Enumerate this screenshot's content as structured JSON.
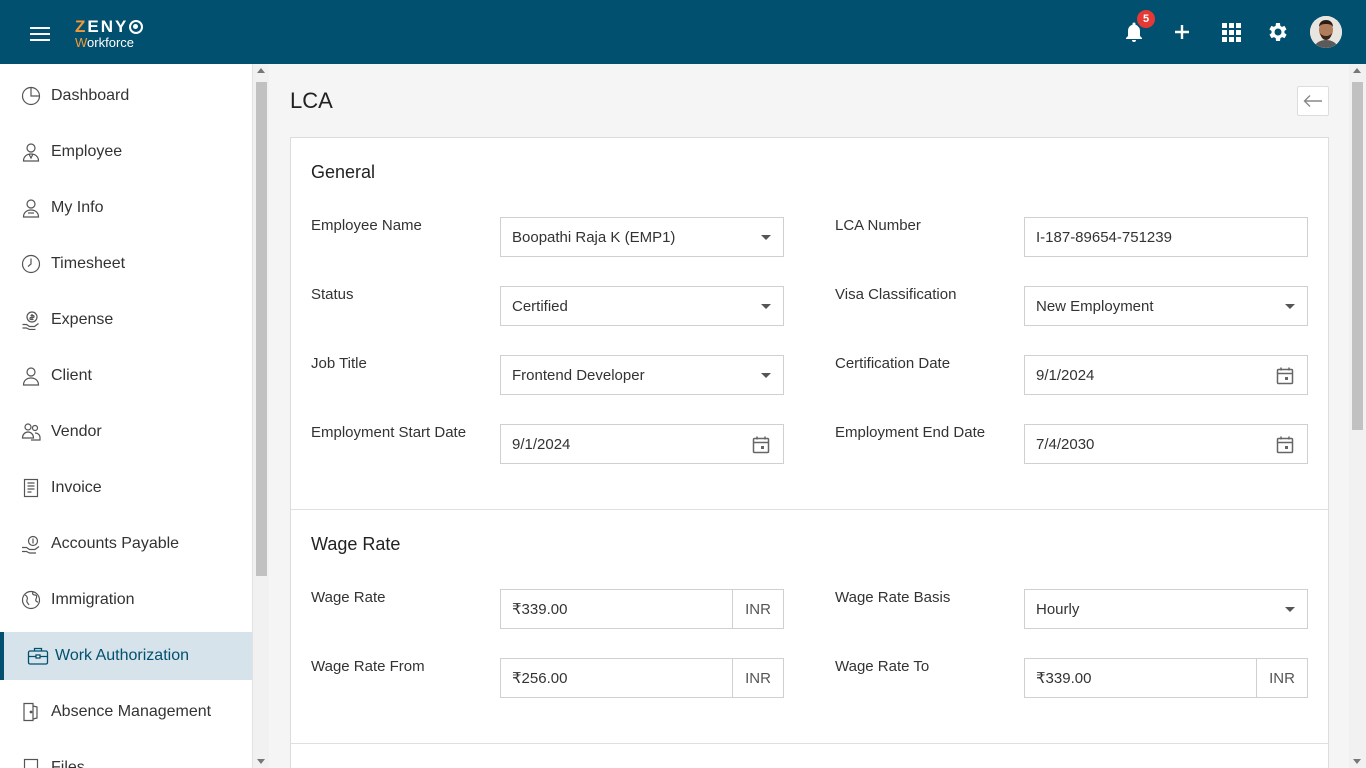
{
  "header": {
    "logo_main_z": "Z",
    "logo_main_rest": "ENY",
    "logo_sub_w": "W",
    "logo_sub_rest": "orkforce",
    "notification_count": "5",
    "colors": {
      "bar": "#02506f",
      "accent": "#f39a36",
      "badge": "#e53935"
    }
  },
  "sidebar": {
    "items": [
      {
        "label": "Dashboard",
        "icon": "dashboard-icon"
      },
      {
        "label": "Employee",
        "icon": "employee-icon"
      },
      {
        "label": "My Info",
        "icon": "my-info-icon"
      },
      {
        "label": "Timesheet",
        "icon": "clock-icon"
      },
      {
        "label": "Expense",
        "icon": "expense-icon"
      },
      {
        "label": "Client",
        "icon": "client-icon"
      },
      {
        "label": "Vendor",
        "icon": "vendor-icon"
      },
      {
        "label": "Invoice",
        "icon": "invoice-icon"
      },
      {
        "label": "Accounts Payable",
        "icon": "accounts-payable-icon"
      },
      {
        "label": "Immigration",
        "icon": "globe-icon"
      },
      {
        "label": "Work Authorization",
        "icon": "briefcase-icon",
        "active": true
      },
      {
        "label": "Absence Management",
        "icon": "absence-icon"
      },
      {
        "label": "Files",
        "icon": "files-icon"
      }
    ]
  },
  "page": {
    "title": "LCA"
  },
  "general": {
    "title": "General",
    "employee_name_label": "Employee Name",
    "employee_name_value": "Boopathi Raja K (EMP1)",
    "lca_number_label": "LCA Number",
    "lca_number_value": "I-187-89654-751239",
    "status_label": "Status",
    "status_value": "Certified",
    "visa_label": "Visa Classification",
    "visa_value": "New Employment",
    "job_title_label": "Job Title",
    "job_title_value": "Frontend Developer",
    "cert_date_label": "Certification Date",
    "cert_date_value": "9/1/2024",
    "start_date_label": "Employment Start Date",
    "start_date_value": "9/1/2024",
    "end_date_label": "Employment End Date",
    "end_date_value": "7/4/2030"
  },
  "wage": {
    "title": "Wage Rate",
    "wage_rate_label": "Wage Rate",
    "wage_rate_value": "₹339.00",
    "wage_rate_currency": "INR",
    "basis_label": "Wage Rate Basis",
    "basis_value": "Hourly",
    "from_label": "Wage Rate From",
    "from_value": "₹256.00",
    "from_currency": "INR",
    "to_label": "Wage Rate To",
    "to_value": "₹339.00",
    "to_currency": "INR"
  }
}
